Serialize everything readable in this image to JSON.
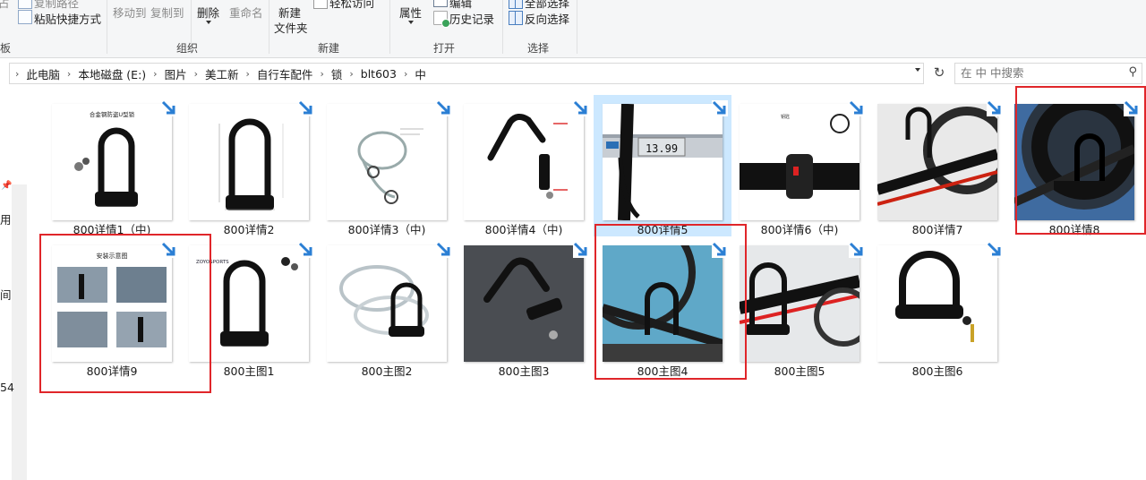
{
  "ribbon": {
    "clipboard": {
      "paste_path": "复制路径",
      "paste_shortcut": "粘贴快捷方式",
      "group_partial": "板"
    },
    "organize": {
      "move_to": "移动到",
      "copy_to": "复制到",
      "delete": "删除",
      "rename": "重命名",
      "group": "组织"
    },
    "new": {
      "new_folder_line1": "新建",
      "new_folder_line2": "文件夹",
      "easy_access": "轻松访问",
      "group": "新建"
    },
    "open": {
      "properties": "属性",
      "edit": "编辑",
      "history": "历史记录",
      "group": "打开"
    },
    "select": {
      "select_all": "全部选择",
      "invert": "反向选择",
      "group": "选择"
    }
  },
  "address": {
    "crumbs": [
      "此电脑",
      "本地磁盘 (E:)",
      "图片",
      "美工新",
      "自行车配件",
      "锁",
      "blt603",
      "中"
    ]
  },
  "search": {
    "placeholder": "在 中 中搜索"
  },
  "nav_fragments": [
    "用",
    "间",
    "54"
  ],
  "files": [
    {
      "name": "800详情1（中)",
      "thumb_title": "合金钢防盗U型锁"
    },
    {
      "name": "800详情2"
    },
    {
      "name": "800详情3（中)"
    },
    {
      "name": "800详情4（中)"
    },
    {
      "name": "800详情5",
      "thumb_reading": "13.99"
    },
    {
      "name": "800详情6（中)"
    },
    {
      "name": "800详情7"
    },
    {
      "name": "800详情8"
    },
    {
      "name": "800详情9",
      "thumb_title": "安装示意图"
    },
    {
      "name": "800主图1",
      "thumb_brand": "ZOYOSPORTS"
    },
    {
      "name": "800主图2"
    },
    {
      "name": "800主图3"
    },
    {
      "name": "800主图4"
    },
    {
      "name": "800主图5"
    },
    {
      "name": "800主图6"
    }
  ],
  "colors": {
    "highlight_box": "#e0262a",
    "selection": "#cce8ff",
    "shortcut_arrow": "#2b7fd4"
  }
}
